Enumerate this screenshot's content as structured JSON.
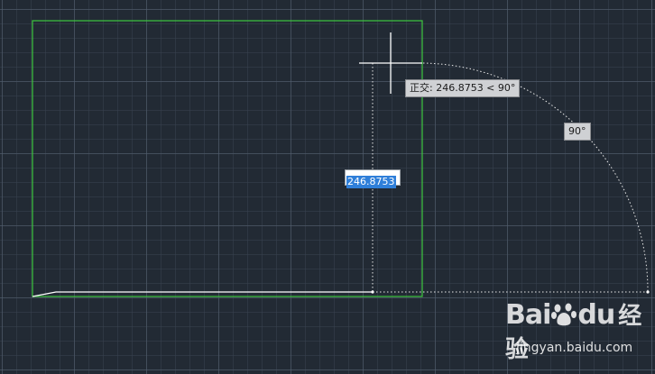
{
  "tooltips": {
    "ortho": "正交: 246.8753 < 90°",
    "angle": "90°"
  },
  "dynamic_input": {
    "value": "246.8753"
  },
  "watermark": {
    "logo_text": "Bai du",
    "brand": "经验",
    "url": "jingyan.baidu.com"
  },
  "colors": {
    "background": "#222a34",
    "grid_major": "#546070",
    "boundary": "#3ec83e",
    "rubber_line": "#ffffff",
    "tooltip_bg": "#cfd1d4",
    "input_highlight": "#2f7fd9"
  }
}
